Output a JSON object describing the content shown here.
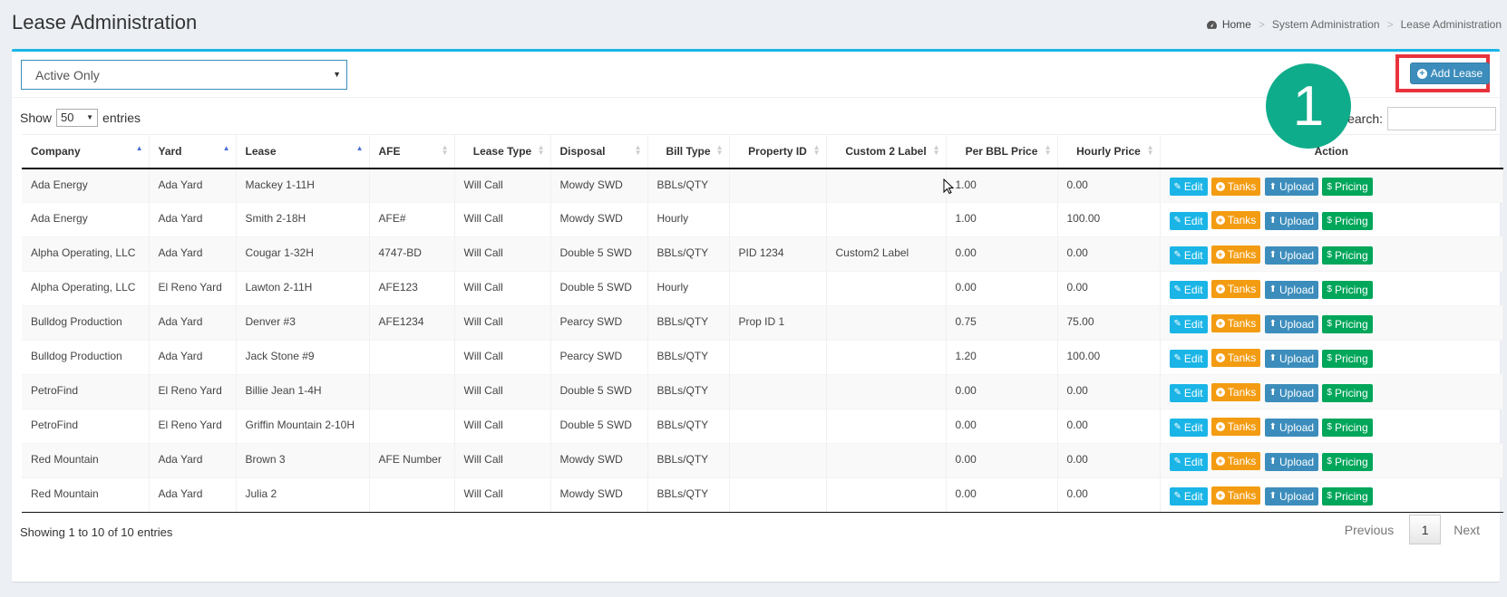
{
  "header": {
    "title": "Lease Administration",
    "breadcrumb": [
      "Home",
      "System Administration",
      "Lease Administration"
    ]
  },
  "filter": {
    "selected": "Active Only"
  },
  "toolbar": {
    "add_lease_label": "Add Lease"
  },
  "callout": {
    "number": "1"
  },
  "length": {
    "show_label": "Show",
    "value": "50",
    "entries_label": "entries"
  },
  "search": {
    "label": "Search:"
  },
  "table": {
    "columns": [
      "Company",
      "Yard",
      "Lease",
      "AFE",
      "Lease Type",
      "Disposal",
      "Bill Type",
      "Property ID",
      "Custom 2 Label",
      "Per BBL Price",
      "Hourly Price",
      "Action"
    ],
    "rows": [
      [
        "Ada Energy",
        "Ada Yard",
        "Mackey 1-11H",
        "",
        "Will Call",
        "Mowdy SWD",
        "BBLs/QTY",
        "",
        "",
        "1.00",
        "0.00"
      ],
      [
        "Ada Energy",
        "Ada Yard",
        "Smith 2-18H",
        "AFE#",
        "Will Call",
        "Mowdy SWD",
        "Hourly",
        "",
        "",
        "1.00",
        "100.00"
      ],
      [
        "Alpha Operating, LLC",
        "Ada Yard",
        "Cougar 1-32H",
        "4747-BD",
        "Will Call",
        "Double 5 SWD",
        "BBLs/QTY",
        "PID 1234",
        "Custom2 Label",
        "0.00",
        "0.00"
      ],
      [
        "Alpha Operating, LLC",
        "El Reno Yard",
        "Lawton 2-11H",
        "AFE123",
        "Will Call",
        "Double 5 SWD",
        "Hourly",
        "",
        "",
        "0.00",
        "0.00"
      ],
      [
        "Bulldog Production",
        "Ada Yard",
        "Denver #3",
        "AFE1234",
        "Will Call",
        "Pearcy SWD",
        "BBLs/QTY",
        "Prop ID 1",
        "",
        "0.75",
        "75.00"
      ],
      [
        "Bulldog Production",
        "Ada Yard",
        "Jack Stone #9",
        "",
        "Will Call",
        "Pearcy SWD",
        "BBLs/QTY",
        "",
        "",
        "1.20",
        "100.00"
      ],
      [
        "PetroFind",
        "El Reno Yard",
        "Billie Jean 1-4H",
        "",
        "Will Call",
        "Double 5 SWD",
        "BBLs/QTY",
        "",
        "",
        "0.00",
        "0.00"
      ],
      [
        "PetroFind",
        "El Reno Yard",
        "Griffin Mountain 2-10H",
        "",
        "Will Call",
        "Double 5 SWD",
        "BBLs/QTY",
        "",
        "",
        "0.00",
        "0.00"
      ],
      [
        "Red Mountain",
        "Ada Yard",
        "Brown 3",
        "AFE Number",
        "Will Call",
        "Mowdy SWD",
        "BBLs/QTY",
        "",
        "",
        "0.00",
        "0.00"
      ],
      [
        "Red Mountain",
        "Ada Yard",
        "Julia 2",
        "",
        "Will Call",
        "Mowdy SWD",
        "BBLs/QTY",
        "",
        "",
        "0.00",
        "0.00"
      ]
    ],
    "actions": [
      "Edit",
      "Tanks",
      "Upload",
      "Pricing"
    ]
  },
  "footer": {
    "info": "Showing 1 to 10 of 10 entries",
    "previous": "Previous",
    "page": "1",
    "next": "Next"
  },
  "colors": {
    "accent": "#1ab5e6",
    "primary": "#3c8dbc",
    "warning": "#f39c12",
    "success": "#00a65a",
    "callout": "#0fac8b",
    "highlight": "#e8333c"
  }
}
